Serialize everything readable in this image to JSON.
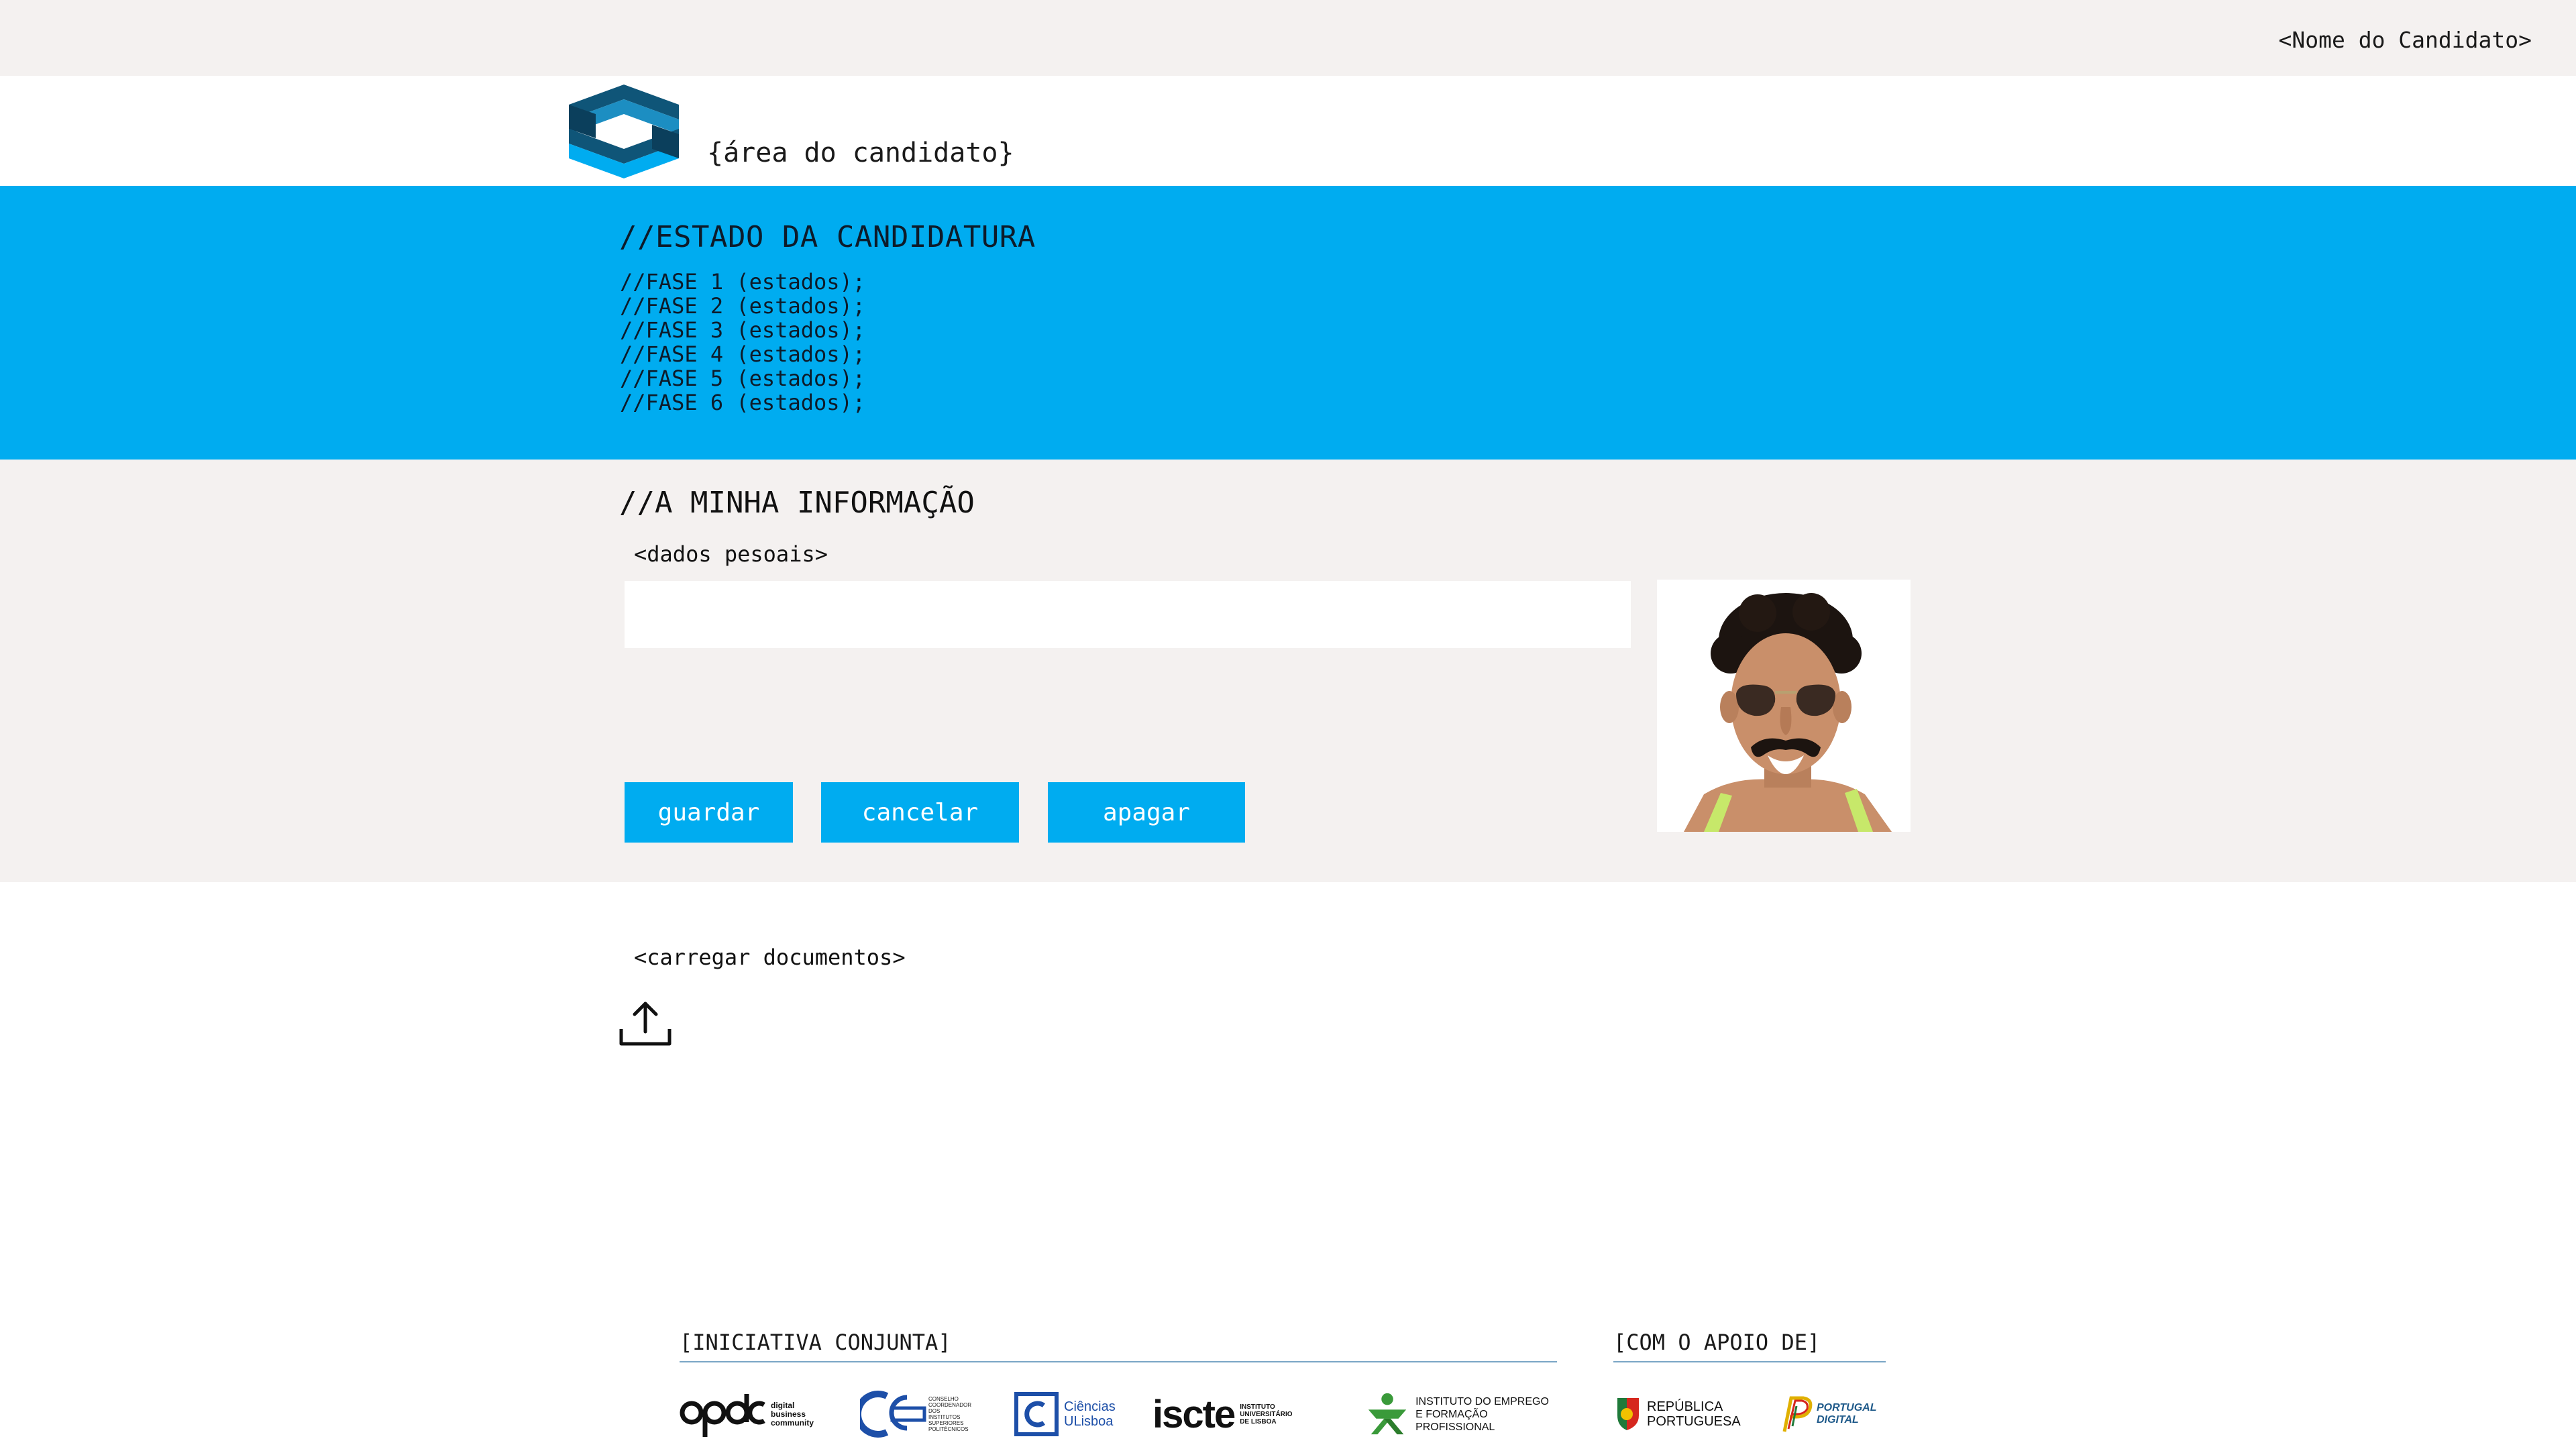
{
  "topbar": {
    "candidate_name": "<Nome do Candidato>"
  },
  "header": {
    "area_title": "{área do candidato}"
  },
  "status": {
    "heading": "//ESTADO DA CANDIDATURA",
    "fases": [
      "//FASE 1 (estados);",
      "//FASE 2 (estados);",
      "//FASE 3 (estados);",
      "//FASE 4 (estados);",
      "//FASE 5 (estados);",
      "//FASE 6 (estados);"
    ]
  },
  "info": {
    "heading": "//A MINHA INFORMAÇÃO",
    "dados_label": "<dados pesoais>",
    "dados_value": "",
    "buttons": {
      "save": "guardar",
      "cancel": "cancelar",
      "delete": "apagar"
    }
  },
  "upload": {
    "label": "<carregar documentos>"
  },
  "footer": {
    "iniciativa_label": "[INICIATIVA CONJUNTA]",
    "apoio_label": "[COM O APOIO DE]",
    "partners": {
      "apdc_lines": [
        "digital",
        "business",
        "community"
      ],
      "ccisp_lines": [
        "CONSELHO",
        "COORDENADOR",
        "DOS",
        "INSTITUTOS",
        "SUPERIORES",
        "POLITÉCNICOS"
      ],
      "ciencias": [
        "Ciências",
        "ULisboa"
      ],
      "iscte": "iscte",
      "iscte_lines": [
        "INSTITUTO",
        "UNIVERSITÁRIO",
        "DE LISBOA"
      ],
      "iefp_lines": [
        "INSTITUTO DO EMPREGO",
        "E FORMAÇÃO PROFISSIONAL"
      ],
      "republica_lines": [
        "REPÚBLICA",
        "PORTUGUESA"
      ],
      "portugal_digital_lines": [
        "PORTUGAL",
        "DIGITAL"
      ]
    }
  },
  "colors": {
    "accent": "#00acf0",
    "band_gray": "#f4f1f0",
    "logo_dark": "#0f4c6b"
  },
  "icons": {
    "upload": "upload-icon",
    "logo": "company-logo"
  }
}
